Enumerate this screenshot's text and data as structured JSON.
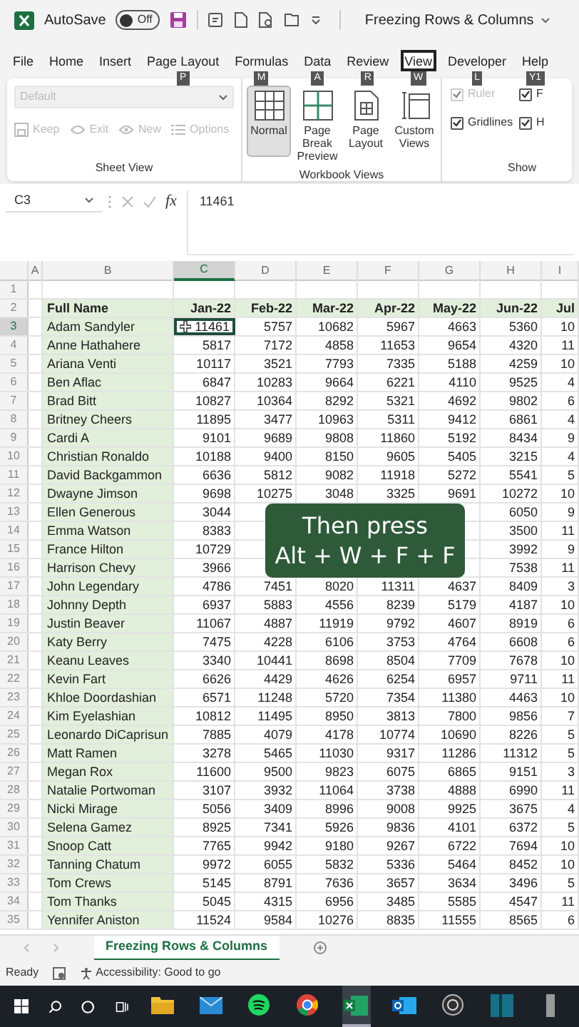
{
  "title_bar": {
    "autosave_label": "AutoSave",
    "autosave": {
      "on": false,
      "label": "Off"
    },
    "document_title": "Freezing Rows & Columns"
  },
  "menu_tabs": [
    {
      "label": "File",
      "selected": false
    },
    {
      "label": "Home",
      "selected": false
    },
    {
      "label": "Insert",
      "selected": false
    },
    {
      "label": "Page Layout",
      "selected": false,
      "keytip": "P"
    },
    {
      "label": "Formulas",
      "selected": false,
      "keytip": "M"
    },
    {
      "label": "Data",
      "selected": false,
      "keytip": "A"
    },
    {
      "label": "Review",
      "selected": false,
      "keytip": "R"
    },
    {
      "label": "View",
      "selected": true,
      "keytip": "W"
    },
    {
      "label": "Developer",
      "selected": false,
      "keytip": "L"
    },
    {
      "label": "Help",
      "selected": false,
      "keytip": "Y1"
    }
  ],
  "ribbon": {
    "sheet_view": {
      "label": "Sheet View",
      "style_select": {
        "value": "Default",
        "disabled": true
      },
      "buttons": [
        {
          "label": "Keep",
          "kind": "keep",
          "disabled": true
        },
        {
          "label": "Exit",
          "kind": "exit",
          "disabled": true
        },
        {
          "label": "New",
          "kind": "new",
          "disabled": true
        },
        {
          "label": "Options",
          "kind": "options",
          "disabled": true
        }
      ]
    },
    "workbook_views": {
      "label": "Workbook Views",
      "buttons": [
        {
          "label": "Normal",
          "kind": "normal",
          "selected": true
        },
        {
          "label": "Page Break Preview",
          "kind": "pagebreak",
          "selected": false
        },
        {
          "label": "Page Layout",
          "kind": "pagelayout",
          "selected": false
        },
        {
          "label": "Custom Views",
          "kind": "custom",
          "selected": false
        }
      ]
    },
    "show": {
      "label": "Show",
      "options": [
        {
          "label": "Ruler",
          "checked": true,
          "disabled": true
        },
        {
          "label": "Gridlines",
          "checked": true,
          "disabled": false
        },
        {
          "label": "F",
          "checked": true,
          "disabled": false
        },
        {
          "label": "H",
          "checked": true,
          "disabled": false
        }
      ]
    }
  },
  "formula_bar": {
    "name_box": "C3",
    "function_button": "fx",
    "value": "11461"
  },
  "sheet": {
    "columns": [
      {
        "letter": "A",
        "selected": false
      },
      {
        "letter": "B",
        "selected": false
      },
      {
        "letter": "C",
        "selected": true
      },
      {
        "letter": "D",
        "selected": false
      },
      {
        "letter": "E",
        "selected": false
      },
      {
        "letter": "F",
        "selected": false
      },
      {
        "letter": "G",
        "selected": false
      },
      {
        "letter": "H",
        "selected": false
      },
      {
        "letter": "I",
        "selected": false
      }
    ],
    "rows": [
      {
        "number": "1",
        "kind": "empty",
        "selected": false
      },
      {
        "number": "2",
        "kind": "header",
        "selected": false,
        "cells": [
          "Full Name",
          "Jan-22",
          "Feb-22",
          "Mar-22",
          "Apr-22",
          "May-22",
          "Jun-22",
          "Jul"
        ]
      },
      {
        "number": "3",
        "kind": "data",
        "selected": true,
        "cells": [
          "Adam Sandyler",
          "11461",
          "5757",
          "10682",
          "5967",
          "4663",
          "5360",
          "10"
        ]
      },
      {
        "number": "4",
        "kind": "data",
        "selected": false,
        "cells": [
          "Anne Hathahere",
          "5817",
          "7172",
          "4858",
          "11653",
          "9654",
          "4320",
          "11"
        ]
      },
      {
        "number": "5",
        "kind": "data",
        "selected": false,
        "cells": [
          "Ariana Venti",
          "10117",
          "3521",
          "7793",
          "7335",
          "5188",
          "4259",
          "10"
        ]
      },
      {
        "number": "6",
        "kind": "data",
        "selected": false,
        "cells": [
          "Ben Aflac",
          "6847",
          "10283",
          "9664",
          "6221",
          "4110",
          "9525",
          "4"
        ]
      },
      {
        "number": "7",
        "kind": "data",
        "selected": false,
        "cells": [
          "Brad Bitt",
          "10827",
          "10364",
          "8292",
          "5321",
          "4692",
          "9802",
          "6"
        ]
      },
      {
        "number": "8",
        "kind": "data",
        "selected": false,
        "cells": [
          "Britney Cheers",
          "11895",
          "3477",
          "10963",
          "5311",
          "9412",
          "6861",
          "4"
        ]
      },
      {
        "number": "9",
        "kind": "data",
        "selected": false,
        "cells": [
          "Cardi A",
          "9101",
          "9689",
          "9808",
          "11860",
          "5192",
          "8434",
          "9"
        ]
      },
      {
        "number": "10",
        "kind": "data",
        "selected": false,
        "cells": [
          "Christian Ronaldo",
          "10188",
          "9400",
          "8150",
          "9605",
          "5405",
          "3215",
          "4"
        ]
      },
      {
        "number": "11",
        "kind": "data",
        "selected": false,
        "cells": [
          "David Backgammon",
          "6636",
          "5812",
          "9082",
          "11918",
          "5272",
          "5541",
          "5"
        ]
      },
      {
        "number": "12",
        "kind": "data",
        "selected": false,
        "cells": [
          "Dwayne Jimson",
          "9698",
          "10275",
          "3048",
          "3325",
          "9691",
          "10272",
          "10"
        ]
      },
      {
        "number": "13",
        "kind": "data",
        "selected": false,
        "cells": [
          "Ellen Generous",
          "3044",
          null,
          null,
          null,
          null,
          "6050",
          "9"
        ]
      },
      {
        "number": "14",
        "kind": "data",
        "selected": false,
        "cells": [
          "Emma Watson",
          "8383",
          null,
          null,
          null,
          null,
          "3500",
          "11"
        ]
      },
      {
        "number": "15",
        "kind": "data",
        "selected": false,
        "cells": [
          "France Hilton",
          "10729",
          null,
          null,
          null,
          null,
          "3992",
          "9"
        ]
      },
      {
        "number": "16",
        "kind": "data",
        "selected": false,
        "cells": [
          "Harrison Chevy",
          "3966",
          null,
          null,
          null,
          null,
          "7538",
          "11"
        ]
      },
      {
        "number": "17",
        "kind": "data",
        "selected": false,
        "cells": [
          "John Legendary",
          "4786",
          "7451",
          "8020",
          "11311",
          "4637",
          "8409",
          "3"
        ]
      },
      {
        "number": "18",
        "kind": "data",
        "selected": false,
        "cells": [
          "Johnny Depth",
          "6937",
          "5883",
          "4556",
          "8239",
          "5179",
          "4187",
          "10"
        ]
      },
      {
        "number": "19",
        "kind": "data",
        "selected": false,
        "cells": [
          "Justin Beaver",
          "11067",
          "4887",
          "11919",
          "9792",
          "4607",
          "8919",
          "6"
        ]
      },
      {
        "number": "20",
        "kind": "data",
        "selected": false,
        "cells": [
          "Katy Berry",
          "7475",
          "4228",
          "6106",
          "3753",
          "4764",
          "6608",
          "6"
        ]
      },
      {
        "number": "21",
        "kind": "data",
        "selected": false,
        "cells": [
          "Keanu Leaves",
          "3340",
          "10441",
          "8698",
          "8504",
          "7709",
          "7678",
          "10"
        ]
      },
      {
        "number": "22",
        "kind": "data",
        "selected": false,
        "cells": [
          "Kevin Fart",
          "6626",
          "4429",
          "4626",
          "6254",
          "6957",
          "9711",
          "11"
        ]
      },
      {
        "number": "23",
        "kind": "data",
        "selected": false,
        "cells": [
          "Khloe Doordashian",
          "6571",
          "11248",
          "5720",
          "7354",
          "11380",
          "4463",
          "10"
        ]
      },
      {
        "number": "24",
        "kind": "data",
        "selected": false,
        "cells": [
          "Kim Eyelashian",
          "10812",
          "11495",
          "8950",
          "3813",
          "7800",
          "9856",
          "7"
        ]
      },
      {
        "number": "25",
        "kind": "data",
        "selected": false,
        "cells": [
          "Leonardo DiCaprisun",
          "7885",
          "4079",
          "4178",
          "10774",
          "10690",
          "8226",
          "5"
        ]
      },
      {
        "number": "26",
        "kind": "data",
        "selected": false,
        "cells": [
          "Matt Ramen",
          "3278",
          "5465",
          "11030",
          "9317",
          "11286",
          "11312",
          "5"
        ]
      },
      {
        "number": "27",
        "kind": "data",
        "selected": false,
        "cells": [
          "Megan Rox",
          "11600",
          "9500",
          "9823",
          "6075",
          "6865",
          "9151",
          "3"
        ]
      },
      {
        "number": "28",
        "kind": "data",
        "selected": false,
        "cells": [
          "Natalie Portwoman",
          "3107",
          "3932",
          "11064",
          "3738",
          "4888",
          "6990",
          "11"
        ]
      },
      {
        "number": "29",
        "kind": "data",
        "selected": false,
        "cells": [
          "Nicki Mirage",
          "5056",
          "3409",
          "8996",
          "9008",
          "9925",
          "3675",
          "4"
        ]
      },
      {
        "number": "30",
        "kind": "data",
        "selected": false,
        "cells": [
          "Selena Gamez",
          "8925",
          "7341",
          "5926",
          "9836",
          "4101",
          "6372",
          "5"
        ]
      },
      {
        "number": "31",
        "kind": "data",
        "selected": false,
        "cells": [
          "Snoop Catt",
          "7765",
          "9942",
          "9180",
          "9267",
          "6722",
          "7694",
          "10"
        ]
      },
      {
        "number": "32",
        "kind": "data",
        "selected": false,
        "cells": [
          "Tanning Chatum",
          "9972",
          "6055",
          "5832",
          "5336",
          "5464",
          "8452",
          "10"
        ]
      },
      {
        "number": "33",
        "kind": "data",
        "selected": false,
        "cells": [
          "Tom Crews",
          "5145",
          "8791",
          "7636",
          "3657",
          "3634",
          "3496",
          "5"
        ]
      },
      {
        "number": "34",
        "kind": "data",
        "selected": false,
        "cells": [
          "Tom Thanks",
          "5045",
          "4315",
          "6956",
          "3485",
          "5585",
          "4547",
          "11"
        ]
      },
      {
        "number": "35",
        "kind": "data",
        "selected": false,
        "cells": [
          "Yennifer Aniston",
          "11524",
          "9584",
          "10276",
          "8835",
          "11555",
          "8565",
          "6"
        ]
      }
    ]
  },
  "overlay": {
    "lines": [
      "Then press",
      "Alt + W + F + F"
    ]
  },
  "sheet_tabs": [
    {
      "label": "Freezing Rows & Columns",
      "selected": true
    }
  ],
  "status_bar": {
    "ready": "Ready",
    "accessibility": "Accessibility: Good to go"
  },
  "taskbar": {
    "apps": [
      {
        "kind": "explorer",
        "selected": false
      },
      {
        "kind": "mail",
        "selected": false
      },
      {
        "kind": "music",
        "selected": false
      },
      {
        "kind": "browser",
        "selected": false
      },
      {
        "kind": "excel",
        "selected": true
      },
      {
        "kind": "outlook",
        "selected": false
      },
      {
        "kind": "recorder",
        "selected": false
      },
      {
        "kind": "panel",
        "selected": false
      },
      {
        "kind": "more",
        "selected": false
      }
    ]
  }
}
